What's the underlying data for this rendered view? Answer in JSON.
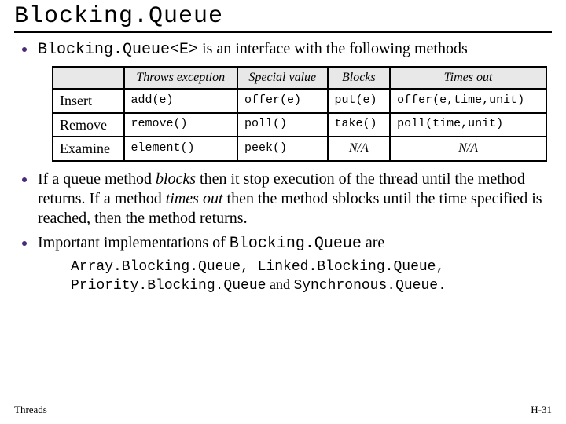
{
  "title": "Blocking.Queue",
  "bullet1": {
    "code": "Blocking.Queue<E>",
    "rest": " is an interface with the following methods"
  },
  "table": {
    "headers": [
      "Throws exception",
      "Special value",
      "Blocks",
      "Times out"
    ],
    "rows": [
      {
        "label": "Insert",
        "cells": [
          "add(e)",
          "offer(e)",
          "put(e)",
          "offer(e,time,unit)"
        ]
      },
      {
        "label": "Remove",
        "cells": [
          "remove()",
          "poll()",
          "take()",
          "poll(time,unit)"
        ]
      },
      {
        "label": "Examine",
        "cells": [
          "element()",
          "peek()",
          "N/A",
          "N/A"
        ]
      }
    ]
  },
  "bullet2": {
    "t1": "If a queue method ",
    "i1": "blocks",
    "t2": " then it stop execution of the thread until the method returns.  If a method ",
    "i2": "times out",
    "t3": " then the method sblocks until the time specified is reached, then the method returns."
  },
  "bullet3": {
    "t1": "Important implementations of ",
    "c1": "Blocking.Queue",
    "t2": " are"
  },
  "impls": {
    "line1": "Array.Blocking.Queue, Linked.Blocking.Queue,",
    "line2a": "Priority.Blocking.Queue",
    "line2_and": " and ",
    "line2b": "Synchronous.Queue."
  },
  "footer": {
    "left": "Threads",
    "right": "H-31"
  }
}
